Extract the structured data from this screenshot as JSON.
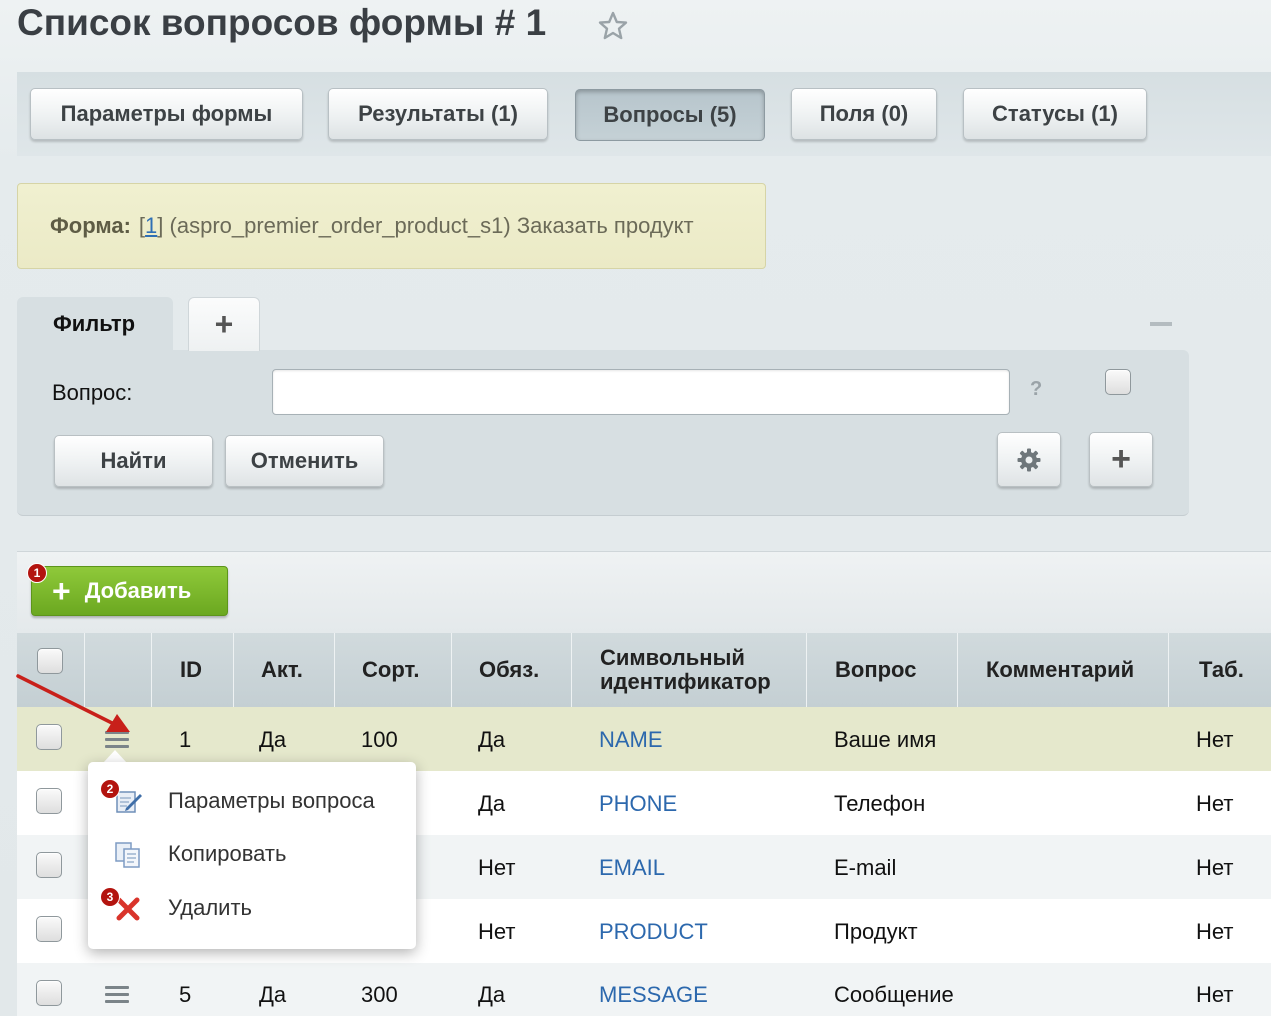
{
  "page": {
    "title": "Список вопросов формы # 1"
  },
  "tabs": [
    {
      "label": "Параметры формы"
    },
    {
      "label": "Результаты (1)"
    },
    {
      "label": "Вопросы (5)"
    },
    {
      "label": "Поля (0)"
    },
    {
      "label": "Статусы (1)"
    }
  ],
  "notice": {
    "label": "Форма:",
    "link_text": "1",
    "text": "(aspro_premier_order_product_s1) Заказать продукт"
  },
  "filter": {
    "tab_label": "Фильтр",
    "add_tab_label": "+",
    "field_label": "Вопрос:",
    "field_value": "",
    "help": "?",
    "find_label": "Найти",
    "cancel_label": "Отменить",
    "add_label": "+"
  },
  "list": {
    "add_label": "Добавить",
    "badge_add": "1",
    "badge_params": "2",
    "badge_delete": "3"
  },
  "table": {
    "columns": [
      "ID",
      "Акт.",
      "Сорт.",
      "Обяз.",
      "Символьный идентификатор",
      "Вопрос",
      "Комментарий",
      "Таб."
    ],
    "rows": [
      {
        "id": "1",
        "active": "Да",
        "sort": "100",
        "required": "Да",
        "code": "NAME",
        "question": "Ваше имя",
        "comment": "",
        "tab": "Нет"
      },
      {
        "id": "",
        "active": "",
        "sort": "",
        "required": "Да",
        "code": "PHONE",
        "question": "Телефон",
        "comment": "",
        "tab": "Нет"
      },
      {
        "id": "",
        "active": "",
        "sort": "",
        "required": "Нет",
        "code": "EMAIL",
        "question": "E-mail",
        "comment": "",
        "tab": "Нет"
      },
      {
        "id": "",
        "active": "",
        "sort": "",
        "required": "Нет",
        "code": "PRODUCT",
        "question": "Продукт",
        "comment": "",
        "tab": "Нет"
      },
      {
        "id": "5",
        "active": "Да",
        "sort": "300",
        "required": "Да",
        "code": "MESSAGE",
        "question": "Сообщение",
        "comment": "",
        "tab": "Нет"
      }
    ]
  },
  "context_menu": {
    "items": [
      {
        "label": "Параметры вопроса",
        "icon": "edit-icon"
      },
      {
        "label": "Копировать",
        "icon": "copy-icon"
      },
      {
        "label": "Удалить",
        "icon": "delete-icon"
      }
    ]
  },
  "colors": {
    "add_button": "#7ab82a",
    "badge": "#b3140f",
    "link": "#2c68ad",
    "highlight_row": "#e5e8cc",
    "arrow": "#c8201a"
  }
}
